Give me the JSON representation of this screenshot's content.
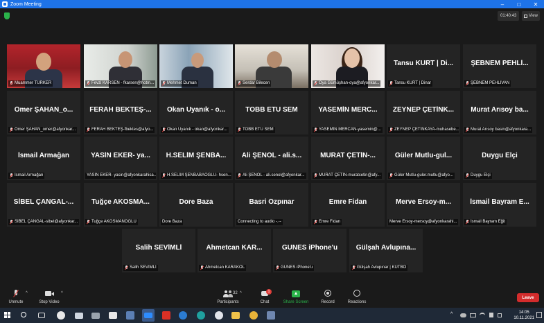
{
  "window": {
    "title": "Zoom Meeting"
  },
  "meeting": {
    "timer": "01:40:43",
    "view_label": "View"
  },
  "tiles_row1": [
    {
      "label": "Muammer TÜRKER",
      "video": true,
      "active": true
    },
    {
      "label": "Fevzi KARSEN - fkarsen@hotm...",
      "video": true
    },
    {
      "label": "Mehmet Duman",
      "video": true
    },
    {
      "label": "Serdar Bilecen",
      "video": true
    },
    {
      "label": "Oya Gümüşhan-oya@afyonkar...",
      "video": true
    },
    {
      "big": "Tansu KURT | Di...",
      "label": "Tansu KURT | Dinar"
    },
    {
      "big": "ŞEBNEM PEHLİ...",
      "label": "ŞEBNEM PEHLİVAN"
    }
  ],
  "tiles_row2": [
    {
      "big": "Ömer ŞAHAN_o...",
      "label": "Ömer ŞAHAN_omer@afyonkar..."
    },
    {
      "big": "FERAH BEKTEŞ-...",
      "label": "FERAH BEKTEŞ-fbektes@afyo..."
    },
    {
      "big": "Okan Uyanık - o...",
      "label": "Okan Uyanık - okan@afyonkar..."
    },
    {
      "big": "TOBB ETU SEM",
      "label": "TOBB ETU SEM"
    },
    {
      "big": "YASEMİN MERC...",
      "label": "YASEMİN MERCAN-yasemin@..."
    },
    {
      "big": "ZEYNEP ÇETİNK...",
      "label": "ZEYNEP ÇETİNKAYA-muhasebe..."
    },
    {
      "big": "Murat Arısoy ba...",
      "label": "Murat Arısoy basin@afyonkara..."
    }
  ],
  "tiles_row3": [
    {
      "big": "İsmail Armağan",
      "label": "İsmail Armağan"
    },
    {
      "big": "YASİN EKER- ya...",
      "label": "YASİN EKER- yasin@afyonkarahisa...",
      "nomic": true
    },
    {
      "big": "H.SELİM ŞENBA...",
      "label": "H.SELİM ŞENBABAOĞLU- hsen..."
    },
    {
      "big": "Ali ŞENOL - ali.s...",
      "label": "Ali ŞENOL - ali.senol@afyonkar..."
    },
    {
      "big": "MURAT ÇETİN-...",
      "label": "MURAT ÇETİN-muratcetin@afy..."
    },
    {
      "big": "Güler Mutlu-gul...",
      "label": "Güler Mutlu-guler.mutlu@afyo..."
    },
    {
      "big": "Duygu Elçi",
      "label": "Duygu Elçi"
    }
  ],
  "tiles_row4": [
    {
      "big": "SİBEL ÇANGAL-...",
      "label": "SİBEL ÇANGAL-sibel@afyonkar..."
    },
    {
      "big": "Tuğçe AKOSMA...",
      "label": "Tuğçe AKOSMANOĞLU"
    },
    {
      "big": "Dore Baza",
      "label": "Dore Baza",
      "nomic": true
    },
    {
      "big": "Basri Özpınar",
      "label": "Connecting to audio -.--",
      "nomic": true
    },
    {
      "big": "Emre Fidan",
      "label": "Emre Fidan"
    },
    {
      "big": "Merve Ersoy-m...",
      "label": "Merve Ersoy-mersoy@afyonkarahi...",
      "nomic": true
    },
    {
      "big": "İsmail Bayram E...",
      "label": "İsmail Bayram Eğit"
    }
  ],
  "tiles_row5": [
    {
      "big": "Salih SEVİMLİ",
      "label": "Salih SEVİMLİ"
    },
    {
      "big": "Ahmetcan KAR...",
      "label": "Ahmetcan KARAKOL"
    },
    {
      "big": "GUNES iPhone'u",
      "label": "GUNES iPhone'u"
    },
    {
      "big": "Gülşah Avlupına...",
      "label": "Gülşah Avlupınar | KÜTBO"
    }
  ],
  "toolbar": {
    "unmute": "Unmute",
    "stop_video": "Stop Video",
    "participants": "Participants",
    "participants_count": "32",
    "chat": "Chat",
    "chat_badge": "1",
    "share_screen": "Share Screen",
    "record": "Record",
    "reactions": "Reactions",
    "leave": "Leave"
  },
  "taskbar": {
    "time": "14:05",
    "date": "10.11.2021"
  },
  "colors": {
    "accent_blue": "#1e73e8",
    "share_green": "#2bb34b",
    "leave_red": "#d32c2c",
    "active_speaker": "#e6e832"
  }
}
